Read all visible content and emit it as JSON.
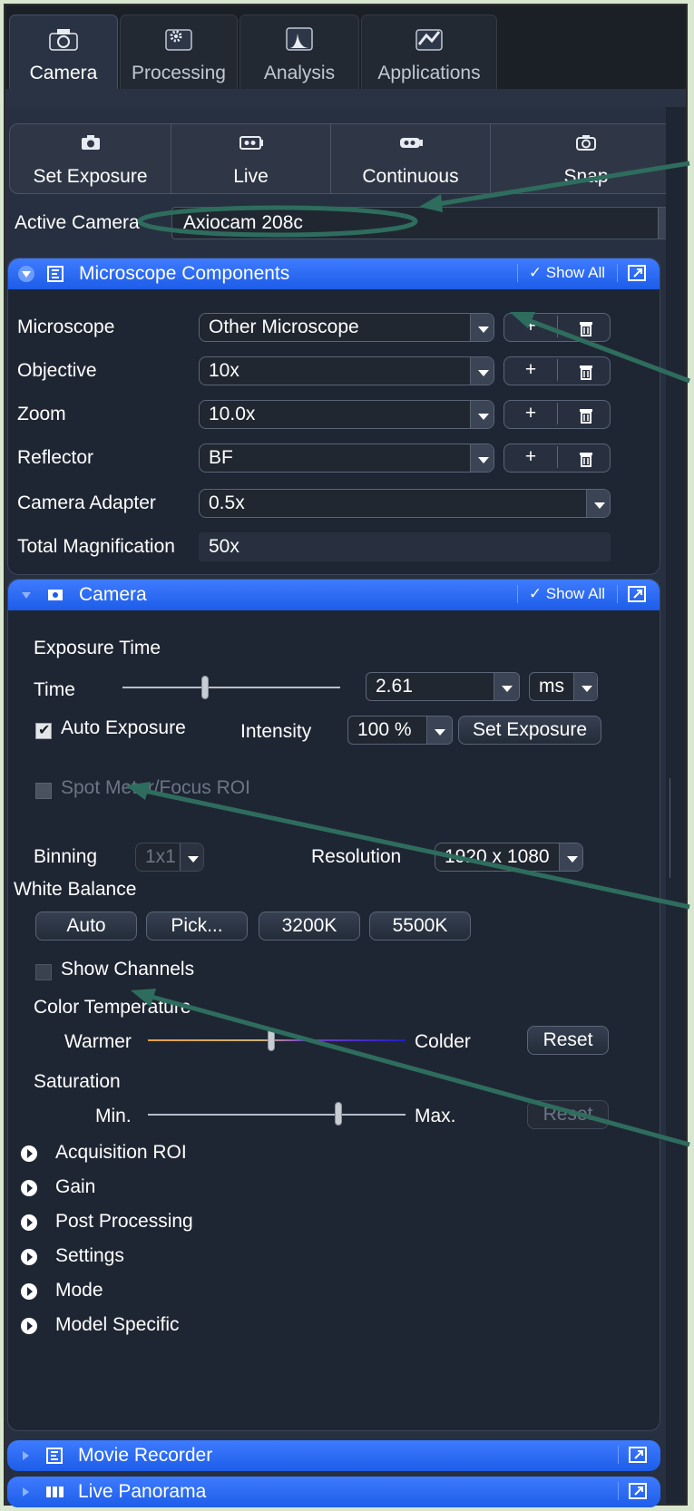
{
  "tabs": [
    {
      "label": "Camera",
      "icon": "camera-icon",
      "active": true
    },
    {
      "label": "Processing",
      "icon": "gear-icon",
      "active": false
    },
    {
      "label": "Analysis",
      "icon": "chart-icon",
      "active": false
    },
    {
      "label": "Applications",
      "icon": "applications-icon",
      "active": false
    }
  ],
  "toolbar": {
    "buttons": [
      {
        "label": "Set Exposure",
        "icon": "exposure-camera-icon"
      },
      {
        "label": "Live",
        "icon": "live-camera-icon"
      },
      {
        "label": "Continuous",
        "icon": "continuous-camera-icon"
      },
      {
        "label": "Snap",
        "icon": "snap-camera-icon"
      }
    ]
  },
  "active_camera": {
    "label": "Active Camera",
    "value": "Axiocam 208c"
  },
  "microscope_panel": {
    "title": "Microscope Components",
    "show_all": "Show All",
    "rows": [
      {
        "label": "Microscope",
        "value": "Other Microscope"
      },
      {
        "label": "Objective",
        "value": "10x"
      },
      {
        "label": "Zoom",
        "value": "10.0x"
      },
      {
        "label": "Reflector",
        "value": "BF"
      },
      {
        "label": "Camera Adapter",
        "value": "0.5x"
      },
      {
        "label": "Total Magnification",
        "value": "50x"
      }
    ],
    "plus": "+"
  },
  "camera_panel": {
    "title": "Camera",
    "show_all": "Show All",
    "exposure_time_heading": "Exposure Time",
    "time_label": "Time",
    "time_value": "2.61",
    "time_unit": "ms",
    "time_slider_fraction": 0.38,
    "auto_exposure_label": "Auto Exposure",
    "auto_exposure_checked": true,
    "intensity_label": "Intensity",
    "intensity_value": "100 %",
    "set_exposure_btn": "Set Exposure",
    "spot_meter_label": "Spot Meter/Focus ROI",
    "binning_label": "Binning",
    "binning_value": "1x1",
    "resolution_label": "Resolution",
    "resolution_value": "1920 x 1080",
    "white_balance_heading": "White Balance",
    "wb_buttons": [
      "Auto",
      "Pick...",
      "3200K",
      "5500K"
    ],
    "show_channels_label": "Show Channels",
    "color_temp_heading": "Color Temperature",
    "warmer_label": "Warmer",
    "colder_label": "Colder",
    "color_temp_fraction": 0.48,
    "reset_label": "Reset",
    "saturation_heading": "Saturation",
    "min_label": "Min.",
    "max_label": "Max.",
    "saturation_fraction": 0.74,
    "sections": [
      "Acquisition ROI",
      "Gain",
      "Post Processing",
      "Settings",
      "Mode",
      "Model Specific"
    ]
  },
  "movie_recorder": {
    "title": "Movie Recorder"
  },
  "live_panorama": {
    "title": "Live Panorama"
  },
  "colors": {
    "header_blue": "#2c6cf5",
    "panel_bg": "#1f2633",
    "annotation_green": "#2e6d5e"
  }
}
